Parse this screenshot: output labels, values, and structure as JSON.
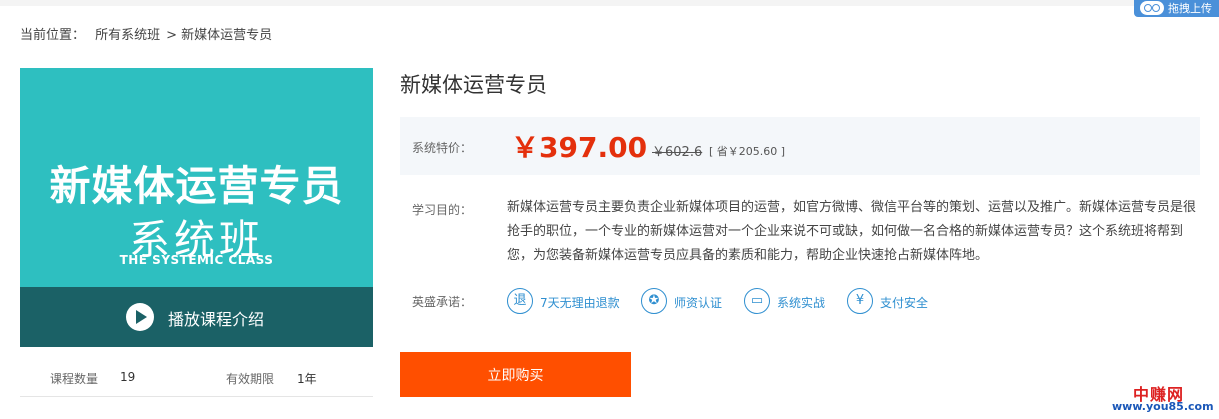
{
  "breadcrumb": {
    "prefix": "当前位置：",
    "items": [
      "所有系统班",
      ">",
      "新媒体运营专员"
    ]
  },
  "upload_tab": {
    "label": "拖拽上传"
  },
  "cover": {
    "title": "新媒体运营专员",
    "subtitle": "系统班",
    "english": "THE SYSTEMIC CLASS",
    "play_label": "播放课程介绍",
    "bg_color": "#2ebfc0",
    "bar_color": "#1b6166"
  },
  "stats": {
    "count_label": "课程数量",
    "count_value": "19",
    "validity_label": "有效期限",
    "validity_value": "1年"
  },
  "course": {
    "title": "新媒体运营专员",
    "price_label": "系统特价：",
    "price_now": "￥397.00",
    "price_old": "￥602.6",
    "price_save": "[ 省￥205.60 ]",
    "goal_label": "学习目的：",
    "goal_text": "新媒体运营专员主要负责企业新媒体项目的运营，如官方微博、微信平台等的策划、运营以及推广。新媒体运营专员是很抢手的职位，一个专业的新媒体运营对一个企业来说不可或缺，如何做一名合格的新媒体运营专员？这个系统班将帮到您，为您装备新媒体运营专员应具备的素质和能力，帮助企业快速抢占新媒体阵地。",
    "promise_label": "英盛承诺：",
    "promises": [
      {
        "icon": "refund-icon",
        "glyph": "退",
        "label": "7天无理由退款"
      },
      {
        "icon": "medal-icon",
        "glyph": "✪",
        "label": "师资认证"
      },
      {
        "icon": "monitor-icon",
        "glyph": "▭",
        "label": "系统实战"
      },
      {
        "icon": "yen-shield-icon",
        "glyph": "¥",
        "label": "支付安全"
      }
    ],
    "buy_label": "立即购买",
    "accent_color": "#ff4f00",
    "price_color": "#e4300c"
  },
  "watermark": {
    "name": "中赚网",
    "url": "www.you85.com"
  }
}
